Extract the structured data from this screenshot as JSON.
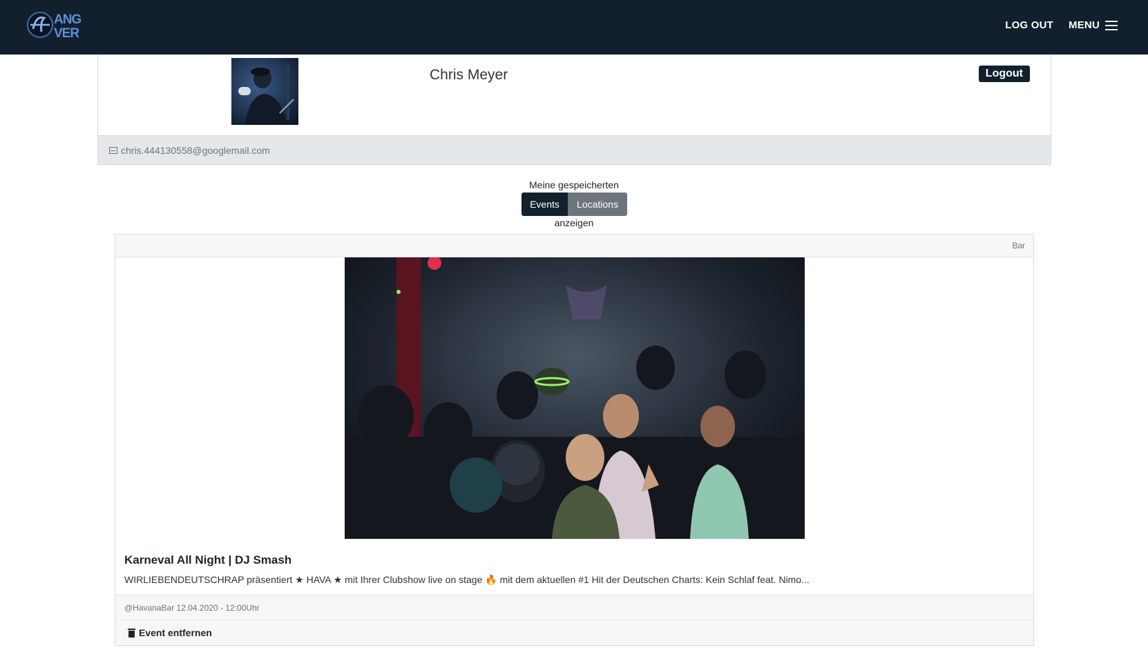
{
  "nav": {
    "logout_label": "LOG OUT",
    "menu_label": "MENU"
  },
  "profile": {
    "name": "Chris Meyer",
    "logout_button": "Logout",
    "email": "chris.444130558@googlemail.com"
  },
  "saved": {
    "intro": "Meine gespeicherten",
    "tabs": [
      "Events",
      "Locations"
    ],
    "active_tab": "Events",
    "outro": "anzeigen"
  },
  "event": {
    "category": "Bar",
    "title": "Karneval All Night | DJ Smash",
    "description": "WIRLIEBENDEUTSCHRAP präsentiert ★ HAVA ★ mit Ihrer Clubshow live on stage 🔥 mit dem aktuellen #1 Hit der Deutschen Charts: Kein Schlaf feat. Nimo...",
    "meta": "@HavanaBar 12.04.2020 - 12:00Uhr",
    "remove_label": "Event entfernen"
  },
  "colors": {
    "nav_bg": "#12202e",
    "secondary": "#6c757d",
    "footer_bg": "#e4e8eb"
  }
}
